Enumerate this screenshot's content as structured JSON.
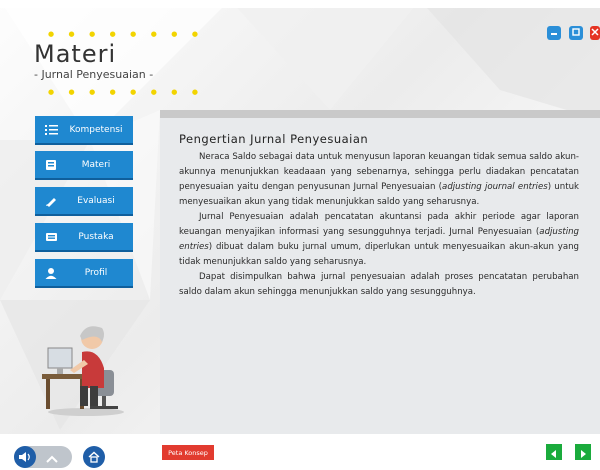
{
  "header": {
    "title": "Materi",
    "subtitle": "- Jurnal Penyesuaian -"
  },
  "window_controls": {
    "minimize_icon": "minimize-icon",
    "maximize_icon": "maximize-icon",
    "close_icon": "close-icon"
  },
  "sidebar": {
    "items": [
      {
        "label": "Kompetensi",
        "icon": "list-icon"
      },
      {
        "label": "Materi",
        "icon": "book-icon"
      },
      {
        "label": "Evaluasi",
        "icon": "pencil-icon"
      },
      {
        "label": "Pustaka",
        "icon": "library-icon"
      },
      {
        "label": "Profil",
        "icon": "user-icon"
      }
    ]
  },
  "content": {
    "heading": "Pengertian Jurnal Penyesuaian",
    "p1a": "Neraca Saldo sebagai data untuk menyusun laporan keuangan tidak semua saldo akun-akunnya menunjukkan keadaaan yang sebenarnya, sehingga perlu diadakan pencatatan penyesuaian yaitu dengan penyusunan Jurnal Penyesuaian (",
    "p1_em": "adjusting journal entries",
    "p1b": ") untuk menyesuaikan akun yang tidak menunjukkan saldo yang seharusnya.",
    "p2a": "Jurnal Penyesuaian adalah pencatatan akuntansi pada akhir periode agar laporan keuangan menyajikan informasi yang sesungguhnya terjadi. Jurnal Penyesuaian (",
    "p2_em": "adjusting entries",
    "p2b": ") dibuat dalam buku jurnal umum, diperlukan untuk menyesuaikan akun-akun yang tidak menunjukkan saldo yang seharusnya.",
    "p3": "Dapat disimpulkan bahwa jurnal penyesuaian adalah proses pencatatan perubahan saldo dalam akun sehingga menunjukkan saldo yang sesungguhnya."
  },
  "footer": {
    "peta_konsep_label": "Peta Konsep",
    "sound_icon": "speaker-icon",
    "toggle_icon": "chevron-up-icon",
    "home_icon": "home-icon",
    "prev_icon": "arrow-left-icon",
    "next_icon": "arrow-right-icon"
  },
  "colors": {
    "menu_blue": "#1f88d0",
    "accent_red": "#e23b2f",
    "nav_green": "#1aab3c",
    "dots_yellow": "#f2d400"
  }
}
